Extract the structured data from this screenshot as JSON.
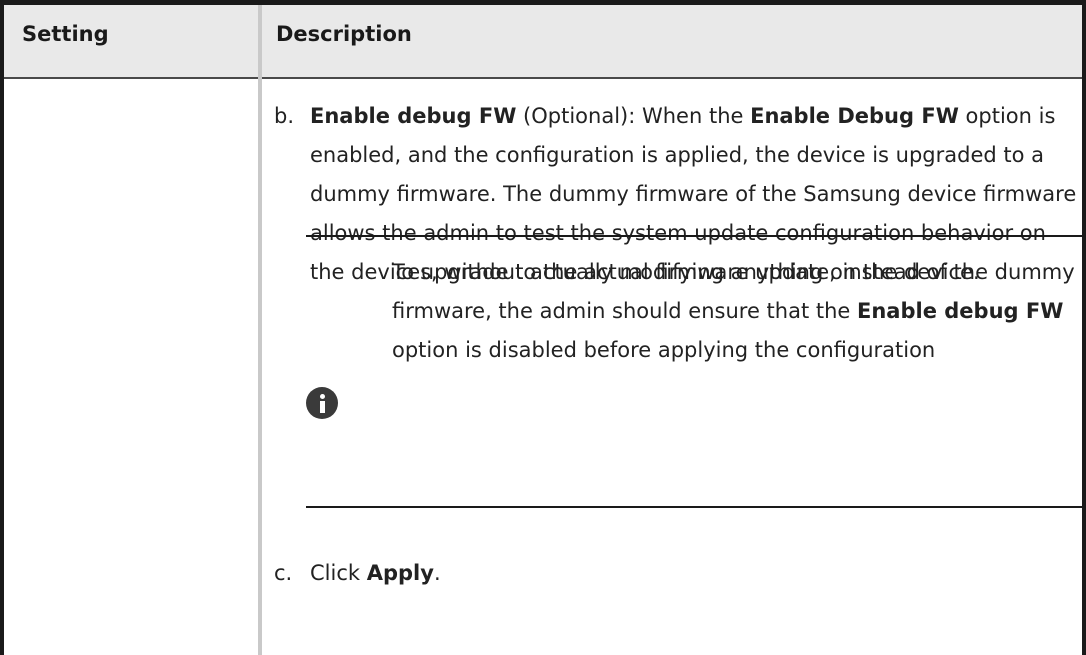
{
  "header": {
    "col_setting": "Setting",
    "col_description": "Description"
  },
  "items": {
    "b": {
      "marker": "b.",
      "title_bold": "Enable debug FW",
      "title_rest": " (Optional): When the ",
      "inline_bold": "Enable Debug FW",
      "text": " option is enabled, and the configuration is applied, the device is upgraded to a dummy firmware. The dummy firmware of the Samsung device firmware allows the admin to test the system update configuration behavior on the devices, without actually modifying anything on the device."
    },
    "c": {
      "marker": "c.",
      "pre": "Click ",
      "bold": "Apply",
      "post": "."
    }
  },
  "note": {
    "icon": "info-icon",
    "text_pre": "To upgrade to the actual firmware update, instead of the dummy firmware, the admin should ensure that the ",
    "text_bold": "Enable debug FW",
    "text_post": " option is disabled before applying the configuration"
  }
}
